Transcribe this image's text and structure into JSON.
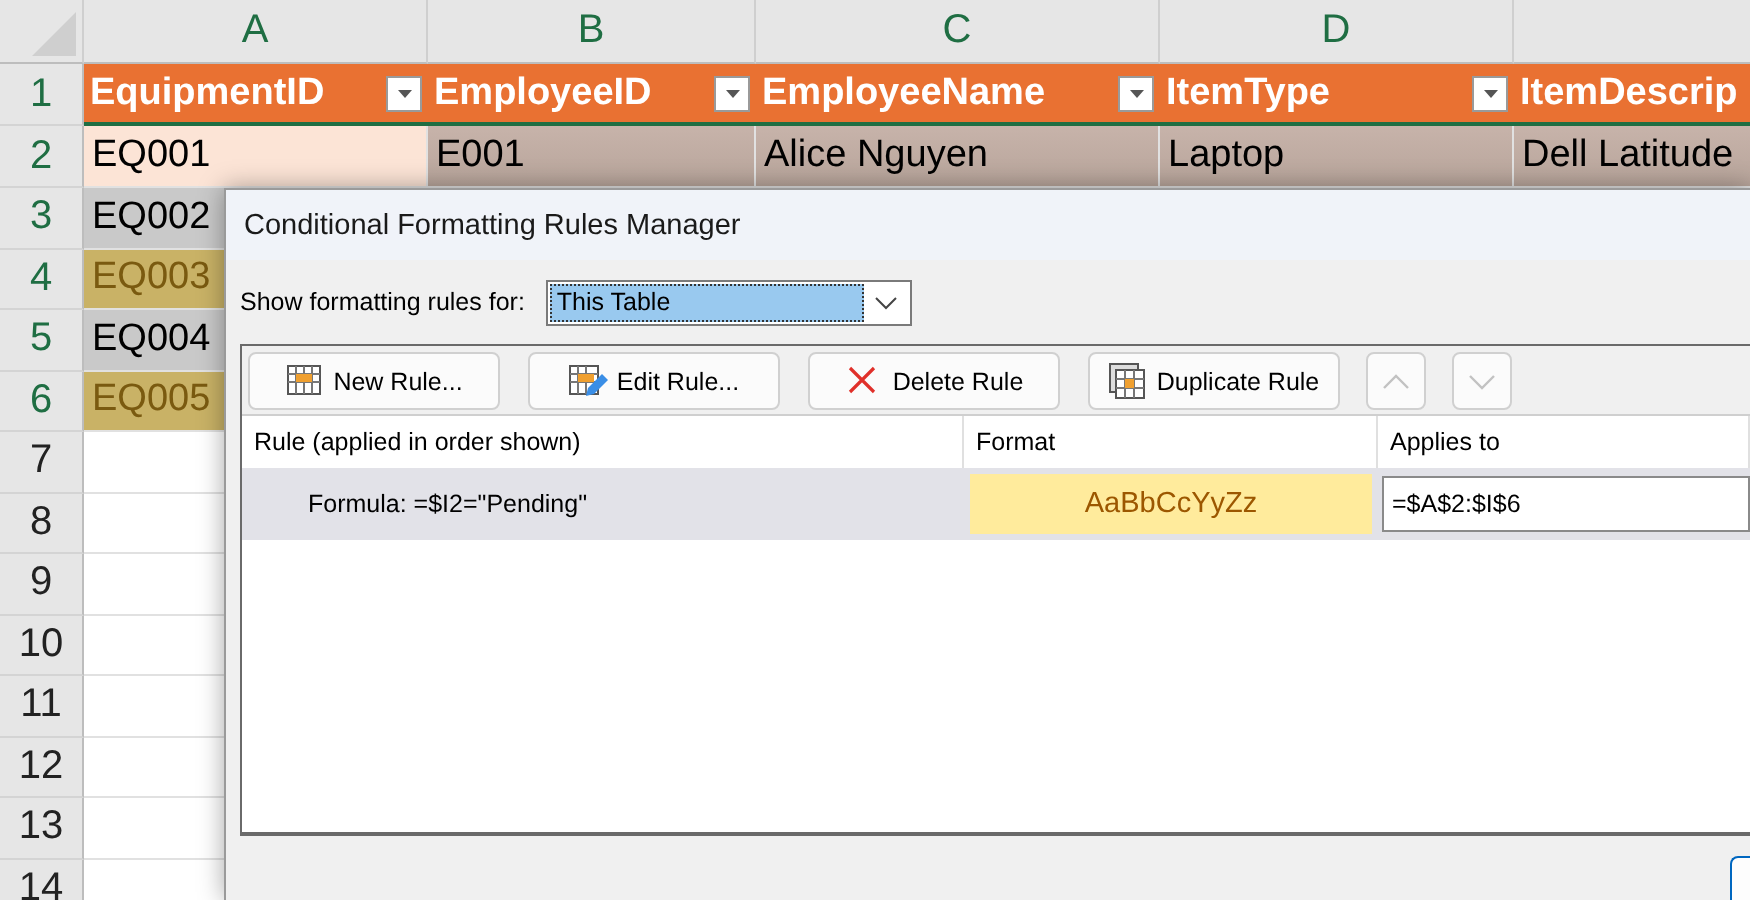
{
  "sheet": {
    "columns": [
      "A",
      "B",
      "C",
      "D"
    ],
    "row_numbers": [
      "1",
      "2",
      "3",
      "4",
      "5",
      "6",
      "7",
      "8",
      "9",
      "10",
      "11",
      "12",
      "13",
      "14"
    ],
    "header": [
      "EquipmentID",
      "EmployeeID",
      "EmployeeName",
      "ItemType",
      "ItemDescrip"
    ],
    "rows": [
      {
        "cells": [
          "EQ001",
          "E001",
          "Alice Nguyen",
          "Laptop",
          "Dell Latitude"
        ],
        "highlighted": false
      },
      {
        "cells": [
          "EQ002"
        ],
        "highlighted": false
      },
      {
        "cells": [
          "EQ003"
        ],
        "highlighted": true
      },
      {
        "cells": [
          "EQ004"
        ],
        "highlighted": false
      },
      {
        "cells": [
          "EQ005"
        ],
        "highlighted": true
      }
    ]
  },
  "dialog": {
    "title": "Conditional Formatting Rules Manager",
    "show_label": "Show formatting rules for:",
    "scope": "This Table",
    "buttons": [
      {
        "kind": "new",
        "label": "New Rule...",
        "disabled": false
      },
      {
        "kind": "edit",
        "label": "Edit Rule...",
        "disabled": false
      },
      {
        "kind": "delete",
        "label": "Delete Rule",
        "disabled": false
      },
      {
        "kind": "duplicate",
        "label": "Duplicate Rule",
        "disabled": false
      },
      {
        "kind": "up",
        "disabled": true
      },
      {
        "kind": "down",
        "disabled": true
      }
    ],
    "columns": [
      "Rule (applied in order shown)",
      "Format",
      "Applies to"
    ],
    "rules": [
      {
        "rule": "Formula: =$I2=\"Pending\"",
        "preview": "AaBbCcYyZz",
        "applies_to": "=$A$2:$I$6",
        "selected": true
      }
    ]
  }
}
